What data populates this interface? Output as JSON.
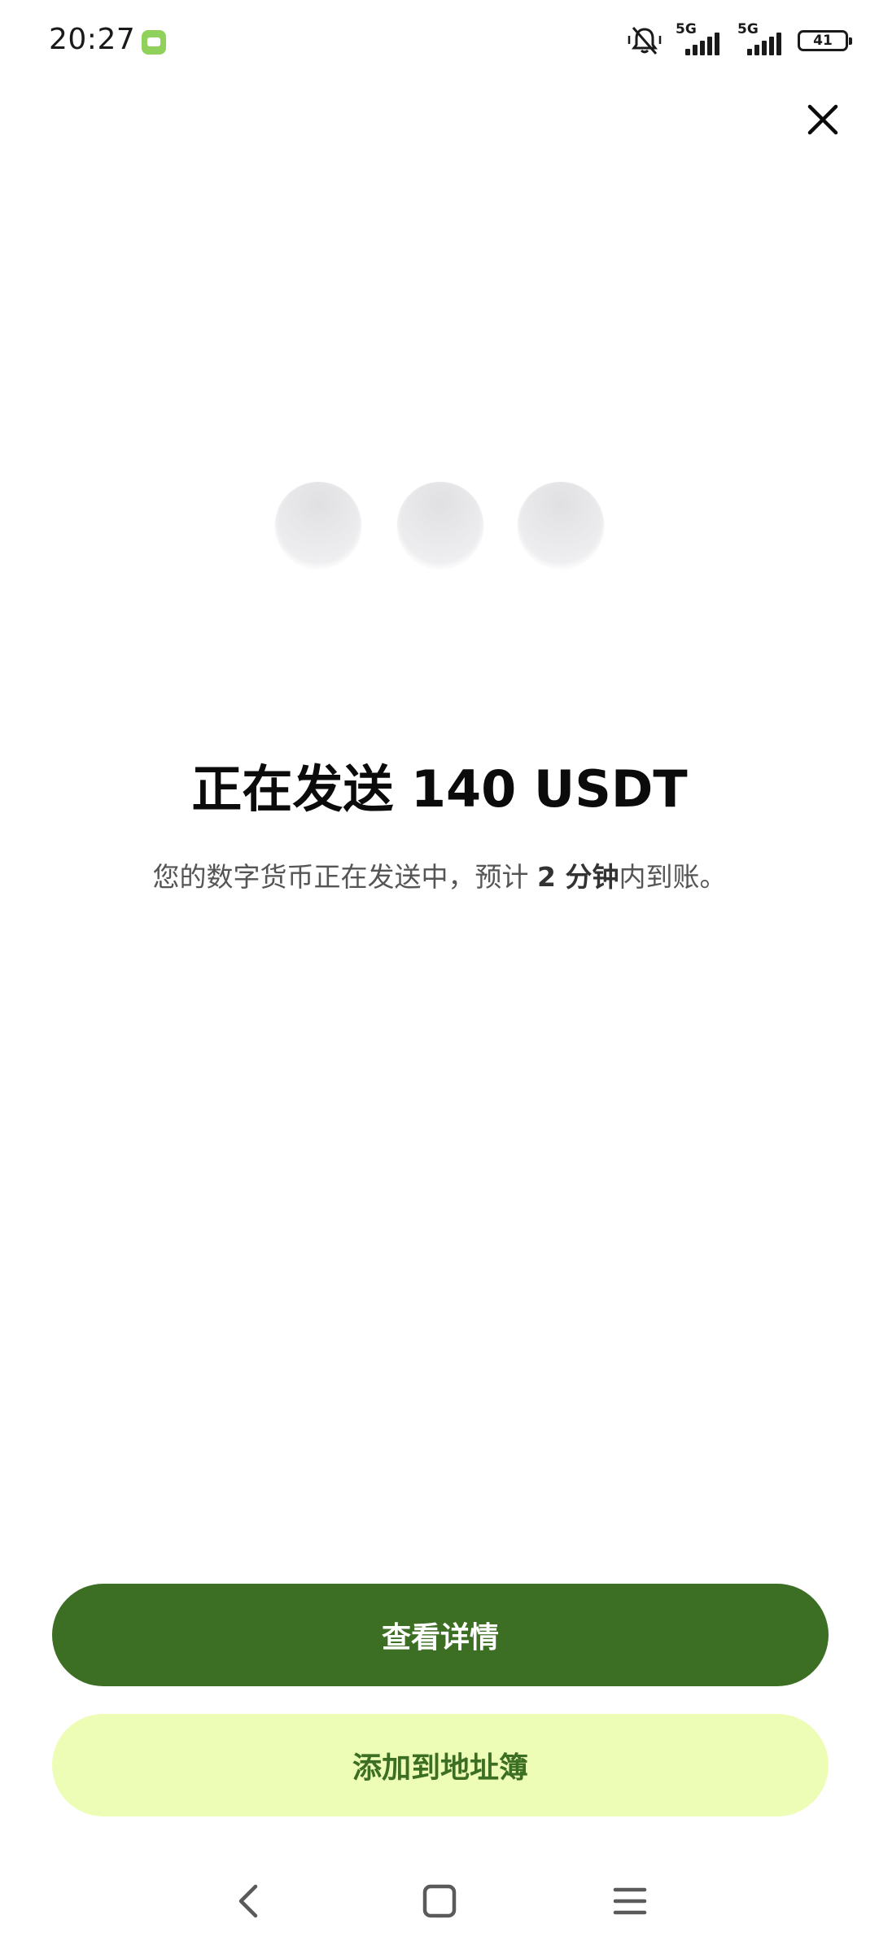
{
  "status_bar": {
    "time": "20:27",
    "network_1": "5G",
    "network_2": "5G",
    "battery_level": "41",
    "icons": [
      "message-icon",
      "mute-icon",
      "signal-icon",
      "battery-icon"
    ]
  },
  "close": {
    "icon": "close-icon"
  },
  "loading": {
    "dot_count": 3
  },
  "main": {
    "title": "正在发送 140 USDT",
    "subtitle_prefix": "您的数字货币正在发送中，预计 ",
    "subtitle_time": "2 分钟",
    "subtitle_suffix": "内到账。"
  },
  "actions": {
    "primary_label": "查看详情",
    "secondary_label": "添加到地址簿"
  },
  "colors": {
    "primary": "#3c6e23",
    "secondary_bg": "#edfdb5",
    "dot": "#e9e9eb"
  },
  "nav_bar": {
    "icons": [
      "back-icon",
      "home-icon",
      "menu-icon"
    ]
  }
}
